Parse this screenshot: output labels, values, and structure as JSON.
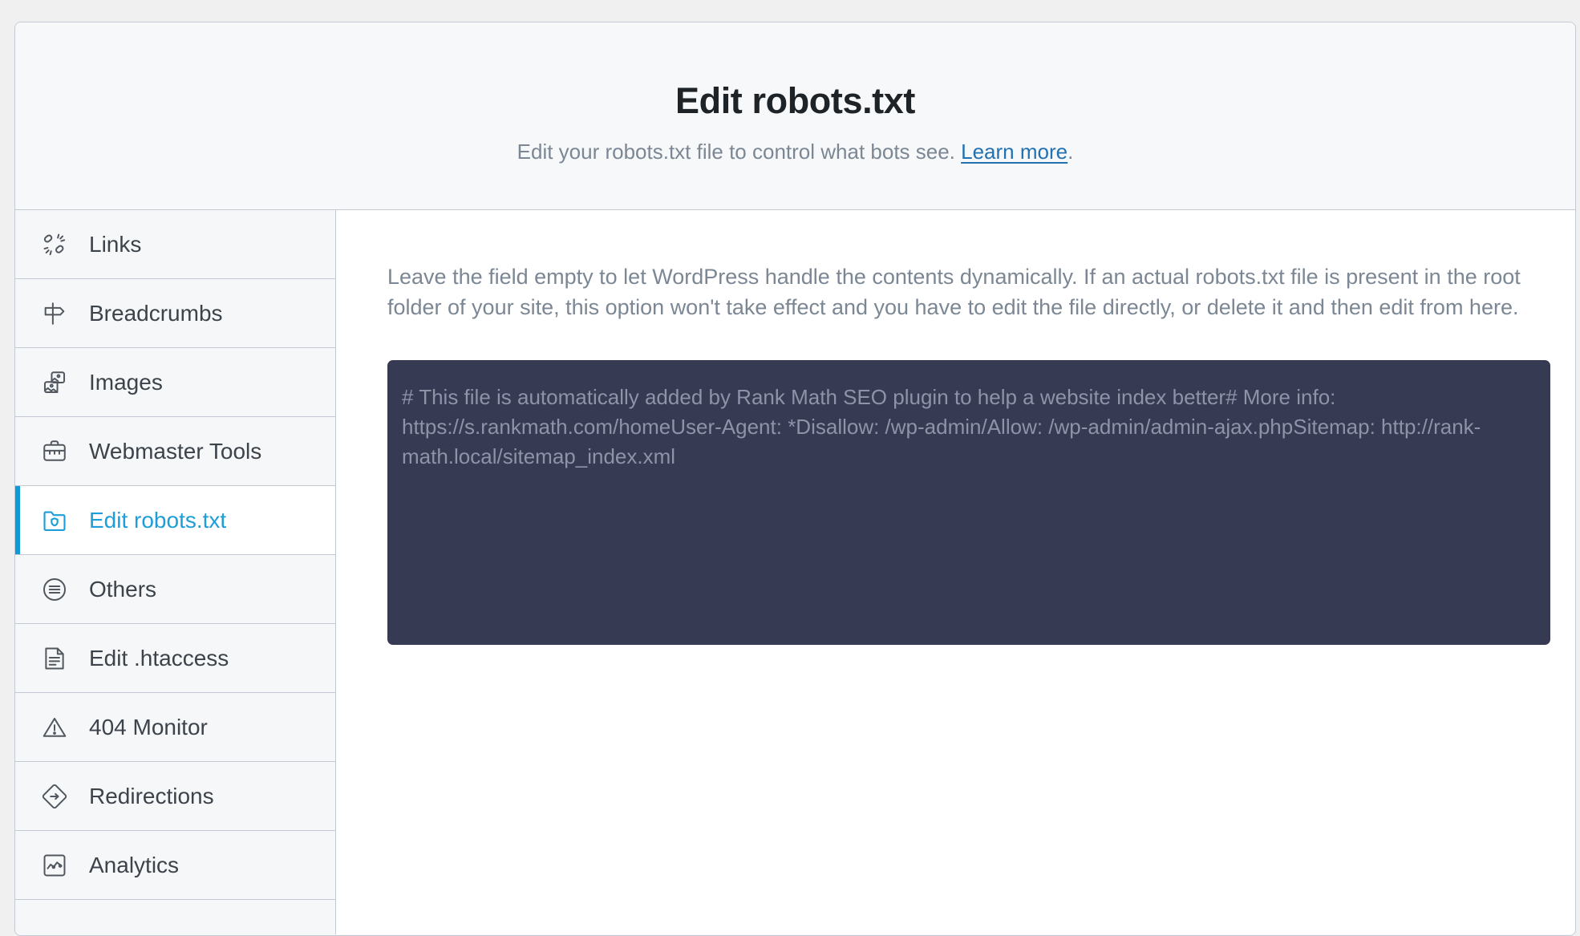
{
  "header": {
    "title": "Edit robots.txt",
    "subtitle_before": "Edit your robots.txt file to control what bots see. ",
    "subtitle_link": "Learn more",
    "subtitle_after": "."
  },
  "sidebar": {
    "items": [
      {
        "label": "Links",
        "icon": "links-icon",
        "active": false
      },
      {
        "label": "Breadcrumbs",
        "icon": "signpost-icon",
        "active": false
      },
      {
        "label": "Images",
        "icon": "images-icon",
        "active": false
      },
      {
        "label": "Webmaster Tools",
        "icon": "toolbox-icon",
        "active": false
      },
      {
        "label": "Edit robots.txt",
        "icon": "folder-shield-icon",
        "active": true
      },
      {
        "label": "Others",
        "icon": "list-circle-icon",
        "active": false
      },
      {
        "label": "Edit .htaccess",
        "icon": "file-lines-icon",
        "active": false
      },
      {
        "label": "404 Monitor",
        "icon": "warning-triangle-icon",
        "active": false
      },
      {
        "label": "Redirections",
        "icon": "diamond-arrow-icon",
        "active": false
      },
      {
        "label": "Analytics",
        "icon": "chart-square-icon",
        "active": false
      }
    ]
  },
  "main": {
    "help_text": "Leave the field empty to let WordPress handle the contents dynamically. If an actual robots.txt file is present in the root folder of your site, this option won't take effect and you have to edit the file directly, or delete it and then edit from here.",
    "textarea": {
      "value": "",
      "placeholder": "# This file is automatically added by Rank Math SEO plugin to help a website index better# More info: https://s.rankmath.com/homeUser-Agent: *Disallow: /wp-admin/Allow: /wp-admin/admin-ajax.phpSitemap: http://rank-math.local/sitemap_index.xml"
    }
  },
  "colors": {
    "accent_blue": "#1e9ed8",
    "link_blue": "#2271b1",
    "textarea_bg": "#363a52",
    "border": "#c3c9d2",
    "muted_text": "#7b8794"
  }
}
